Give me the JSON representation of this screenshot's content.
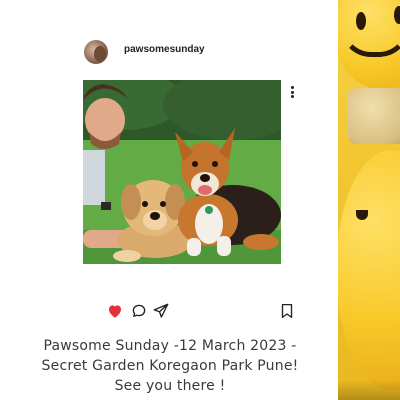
{
  "post": {
    "username": "pawsomesunday",
    "caption": "Pawsome Sunday -12 March 2023 - Secret Garden Koregaon Park Pune!  See you there !",
    "liked": true
  },
  "icons": {
    "avatar": "profile-avatar",
    "more": "more-options-icon",
    "like": "heart-icon",
    "comment": "comment-icon",
    "share": "send-icon",
    "save": "bookmark-icon"
  },
  "colors": {
    "like_active": "#e53238",
    "text": "#3a3a3a",
    "side_yellow": "#f3c632"
  }
}
